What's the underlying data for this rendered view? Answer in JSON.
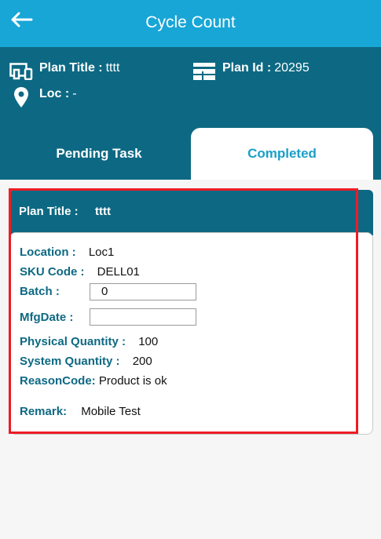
{
  "app_bar": {
    "title": "Cycle Count",
    "back_icon": "arrow-left-icon",
    "background": "#17a6d6"
  },
  "plan_info": {
    "title_label": "Plan Title :",
    "title_value": "tttt",
    "id_label": "Plan Id :",
    "id_value": "20295",
    "loc_label": "Loc :",
    "loc_value": "-",
    "background": "#0d6983"
  },
  "tabs": [
    {
      "label": "Pending Task",
      "active": false
    },
    {
      "label": "Completed",
      "active": true
    }
  ],
  "card": {
    "header_label": "Plan Title :",
    "header_value": "tttt",
    "location_label": "Location :",
    "location_value": "Loc1",
    "sku_label": "SKU Code :",
    "sku_value": "DELL01",
    "batch_label": "Batch :",
    "batch_value": "0",
    "mfg_label": "MfgDate :",
    "mfg_value": "",
    "physical_label": "Physical Quantity :",
    "physical_value": "100",
    "system_label": "System Quantity :",
    "system_value": "200",
    "reason_label": "ReasonCode:",
    "reason_value": "Product is ok",
    "remark_label": "Remark:",
    "remark_value": "Mobile Test"
  },
  "colors": {
    "accent": "#1a9fc9",
    "label": "#0d6983",
    "highlight": "#ee1c24"
  }
}
